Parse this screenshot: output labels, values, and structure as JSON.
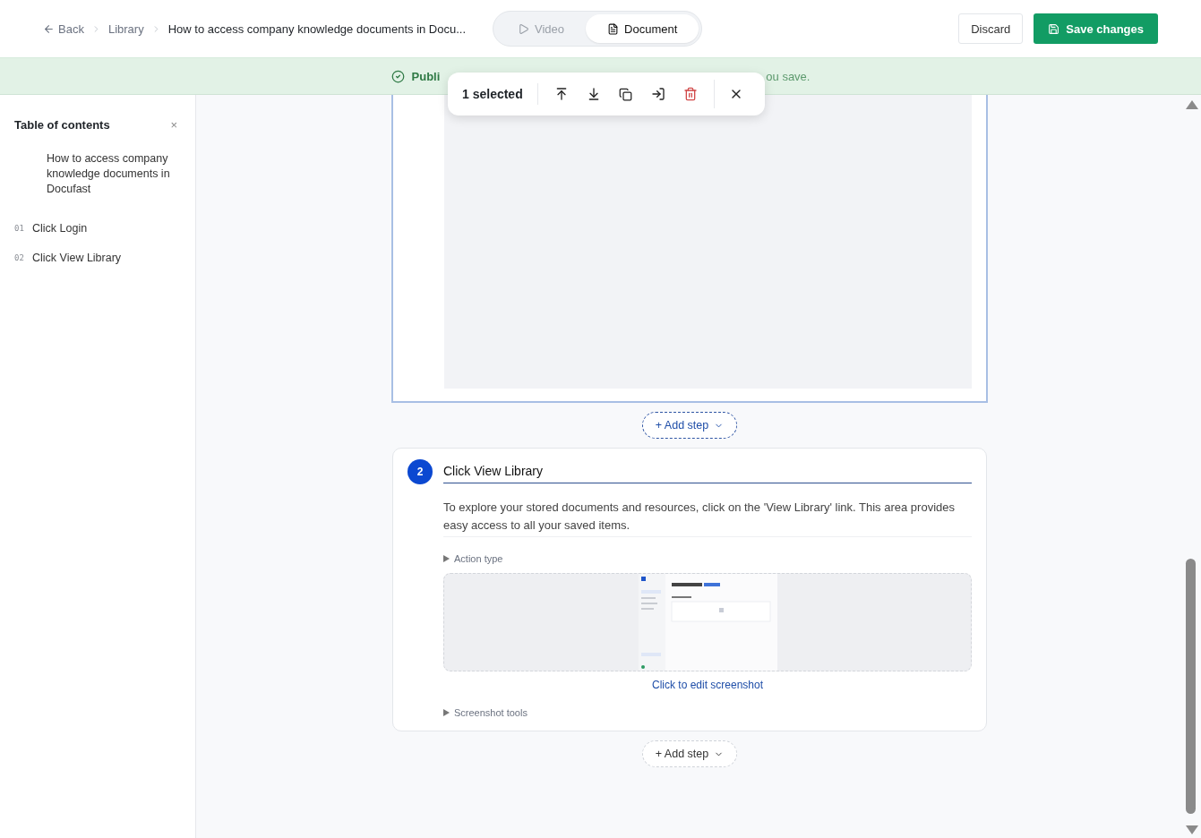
{
  "header": {
    "back": "Back",
    "breadcrumbs": [
      "Library",
      "How to access company knowledge documents in Docu..."
    ],
    "view_tabs": [
      {
        "label": "Video",
        "selected": false
      },
      {
        "label": "Document",
        "selected": true
      }
    ],
    "discard": "Discard",
    "save": "Save changes"
  },
  "banner": {
    "lead": "Publi",
    "tail": "ou save."
  },
  "selection_toolbar": {
    "count": "1 selected"
  },
  "toc": {
    "title": "Table of contents",
    "close": "×",
    "doc_title": "How to access company knowledge documents in Docufast",
    "items": [
      {
        "number": "01",
        "label": "Click Login"
      },
      {
        "number": "02",
        "label": "Click View Library"
      }
    ]
  },
  "steps": [
    {
      "selected": true
    },
    {
      "selected": false,
      "number": "2",
      "title": "Click View Library",
      "description": "To explore your stored documents and resources, click on the 'View Library' link. This area provides easy access to all your saved items.",
      "action_type": "Action type",
      "edit_link": "Click to edit screenshot",
      "tools": "Screenshot tools"
    }
  ],
  "add_steps": [
    {
      "label": "+ Add step",
      "highlighted": true
    },
    {
      "label": "+ Add step",
      "highlighted": false
    }
  ]
}
